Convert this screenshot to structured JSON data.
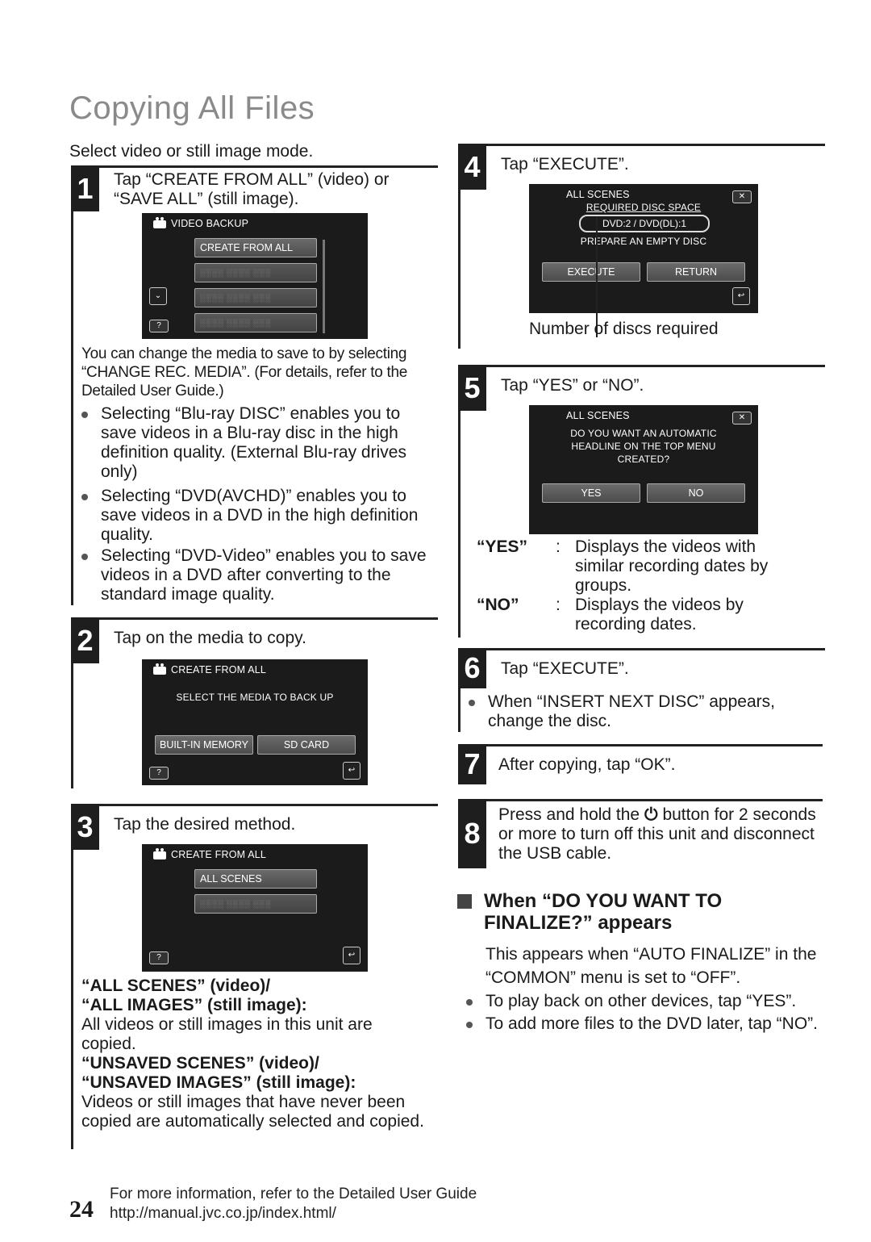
{
  "page": {
    "title": "Copying All Files",
    "intro": "Select video or still image mode.",
    "page_number": "24"
  },
  "steps": [
    {
      "number": "1",
      "text": "Tap “CREATE FROM ALL” (video) or “SAVE ALL” (still image).",
      "screen": {
        "header": "VIDEO BACKUP",
        "icon": "video-camera-icon",
        "buttons": [
          "CREATE FROM ALL",
          "░░░░ ░░░░ ░░░",
          "░░░░ ░░░░ ░░░",
          "░░░░ ░░░░ ░░░"
        ],
        "side_icons": [
          "chevron-down-icon",
          "help-icon"
        ],
        "help_label": "?"
      },
      "note": "You can change the media to save to by selecting “CHANGE REC. MEDIA”. (For details, refer to the Detailed User Guide.)",
      "bullets": [
        "Selecting “Blu-ray DISC” enables you to save videos in a Blu-ray disc in the high definition quality. (External Blu-ray drives only)",
        "Selecting “DVD(AVCHD)” enables you to save videos in a DVD in the high definition quality.",
        "Selecting “DVD-Video” enables you to save videos in a DVD after converting to the standard image quality."
      ]
    },
    {
      "number": "2",
      "text": "Tap on the media to copy.",
      "screen": {
        "header": "CREATE FROM ALL",
        "message": "SELECT THE MEDIA TO BACK UP",
        "buttons": [
          "BUILT-IN MEMORY",
          "SD CARD"
        ],
        "help_label": "?"
      }
    },
    {
      "number": "3",
      "text": "Tap the desired method.",
      "screen": {
        "header": "CREATE FROM ALL",
        "buttons": [
          "ALL SCENES",
          "░░░░ ░░░░ ░░░"
        ],
        "help_label": "?"
      },
      "options": [
        {
          "label_lines": [
            "“ALL SCENES” (video)/",
            "“ALL IMAGES” (still image):"
          ],
          "desc": "All videos or still images in this unit are copied."
        },
        {
          "label_lines": [
            "“UNSAVED SCENES” (video)/",
            "“UNSAVED IMAGES” (still image):"
          ],
          "desc": "Videos or still images that have never been copied are automatically selected and copied."
        }
      ]
    },
    {
      "number": "4",
      "text": "Tap “EXECUTE”.",
      "screen": {
        "header": "ALL SCENES",
        "line1": "REQUIRED DISC SPACE",
        "line2": "DVD:2 / DVD(DL):1",
        "line3": "PREPARE AN EMPTY DISC",
        "buttons": [
          "EXECUTE",
          "RETURN"
        ],
        "close_label": "✕"
      },
      "callout": "Number of discs required"
    },
    {
      "number": "5",
      "text": "Tap “YES” or “NO”.",
      "screen": {
        "header": "ALL SCENES",
        "message_lines": [
          "DO YOU WANT AN AUTOMATIC",
          "HEADLINE ON THE TOP MENU",
          "CREATED?"
        ],
        "buttons": [
          "YES",
          "NO"
        ],
        "close_label": "✕"
      },
      "definitions": [
        {
          "term": "“YES”",
          "sep": ":",
          "desc": "Displays the videos with similar recording dates by groups."
        },
        {
          "term": "“NO”",
          "sep": ":",
          "desc": "Displays the videos by recording dates."
        }
      ]
    },
    {
      "number": "6",
      "text": "Tap “EXECUTE”.",
      "bullets": [
        "When “INSERT NEXT DISC” appears, change the disc."
      ]
    },
    {
      "number": "7",
      "text": "After copying, tap “OK”."
    },
    {
      "number": "8",
      "text_before": "Press and hold the",
      "power_icon": "⏻",
      "text_after": "button for 2 seconds or more to turn off this unit and disconnect the USB cable."
    }
  ],
  "finalize": {
    "heading_lines": [
      "When “DO YOU WANT TO",
      "FINALIZE?” appears"
    ],
    "intro": "This appears when “AUTO FINALIZE” in the “COMMON” menu is set to “OFF”.",
    "bullets": [
      "To play back on other devices, tap “YES”.",
      "To add more files to the DVD later, tap “NO”."
    ]
  },
  "footer": {
    "line1": "For more information, refer to the Detailed User Guide",
    "line2": "http://manual.jvc.co.jp/index.html/"
  }
}
